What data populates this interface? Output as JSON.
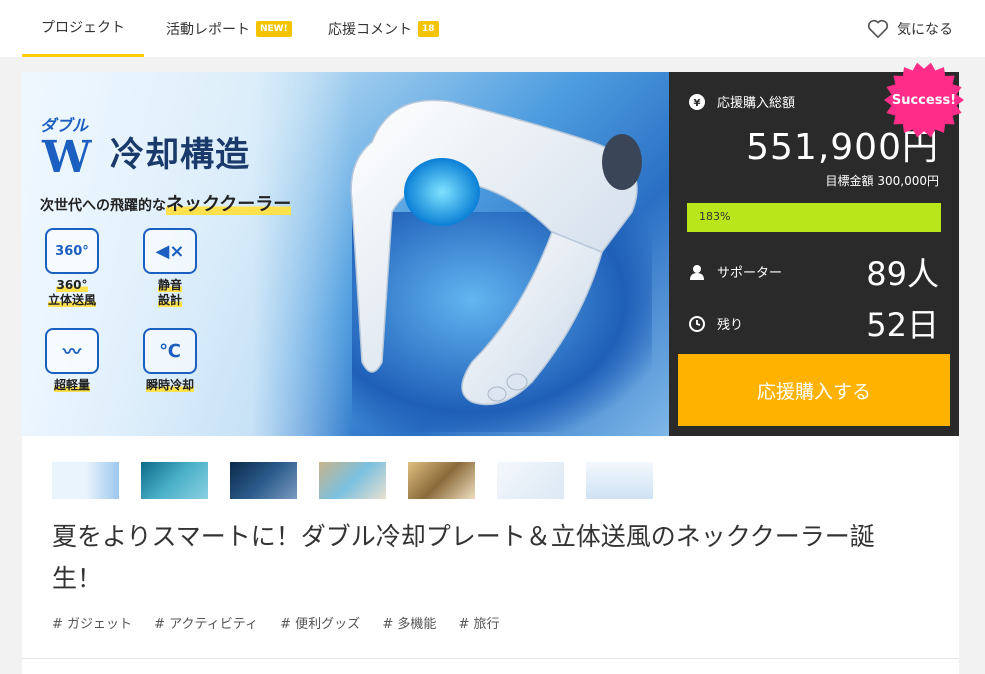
{
  "tabs": {
    "project": "プロジェクト",
    "report": "活動レポート",
    "report_badge": "NEW!",
    "comments": "応援コメント",
    "comments_badge": "18",
    "favorite": "気になる"
  },
  "hero": {
    "double_label": "ダブル",
    "w_label": "W",
    "title": "冷却構造",
    "subtitle_prefix": "次世代への飛躍的な",
    "subtitle_highlight": "ネッククーラー",
    "features": [
      {
        "icon_text": "360°",
        "label_line1": "360°",
        "label_line2": "立体送風"
      },
      {
        "icon_text": "◀×",
        "label_line1": "静音",
        "label_line2": "設計"
      },
      {
        "icon_text": "〰",
        "label_line1": "超軽量",
        "label_line2": ""
      },
      {
        "icon_text": "℃",
        "label_line1": "瞬時冷却",
        "label_line2": ""
      }
    ]
  },
  "sidebar": {
    "total_label": "応援購入総額",
    "total_value": "551,900円",
    "goal_text": "目標金額 300,000円",
    "progress_label": "183%",
    "progress_fraction": 1.0,
    "supporters_label": "サポーター",
    "supporters_value": "89人",
    "remaining_label": "残り",
    "remaining_value": "52日",
    "cta_label": "応援購入する",
    "success_badge": "Success!",
    "accent_color": "#ffb300",
    "progress_color": "#b8e61a",
    "badge_color": "#ff2d8a"
  },
  "thumbnails": [
    "thumb-1",
    "thumb-2",
    "thumb-3",
    "thumb-4",
    "thumb-5",
    "thumb-6",
    "thumb-7"
  ],
  "project_title": "夏をよりスマートに！ダブル冷却プレート＆立体送風のネッククーラー誕生！",
  "tags": [
    "# ガジェット",
    "# アクティビティ",
    "# 便利グッズ",
    "# 多機能",
    "# 旅行"
  ]
}
